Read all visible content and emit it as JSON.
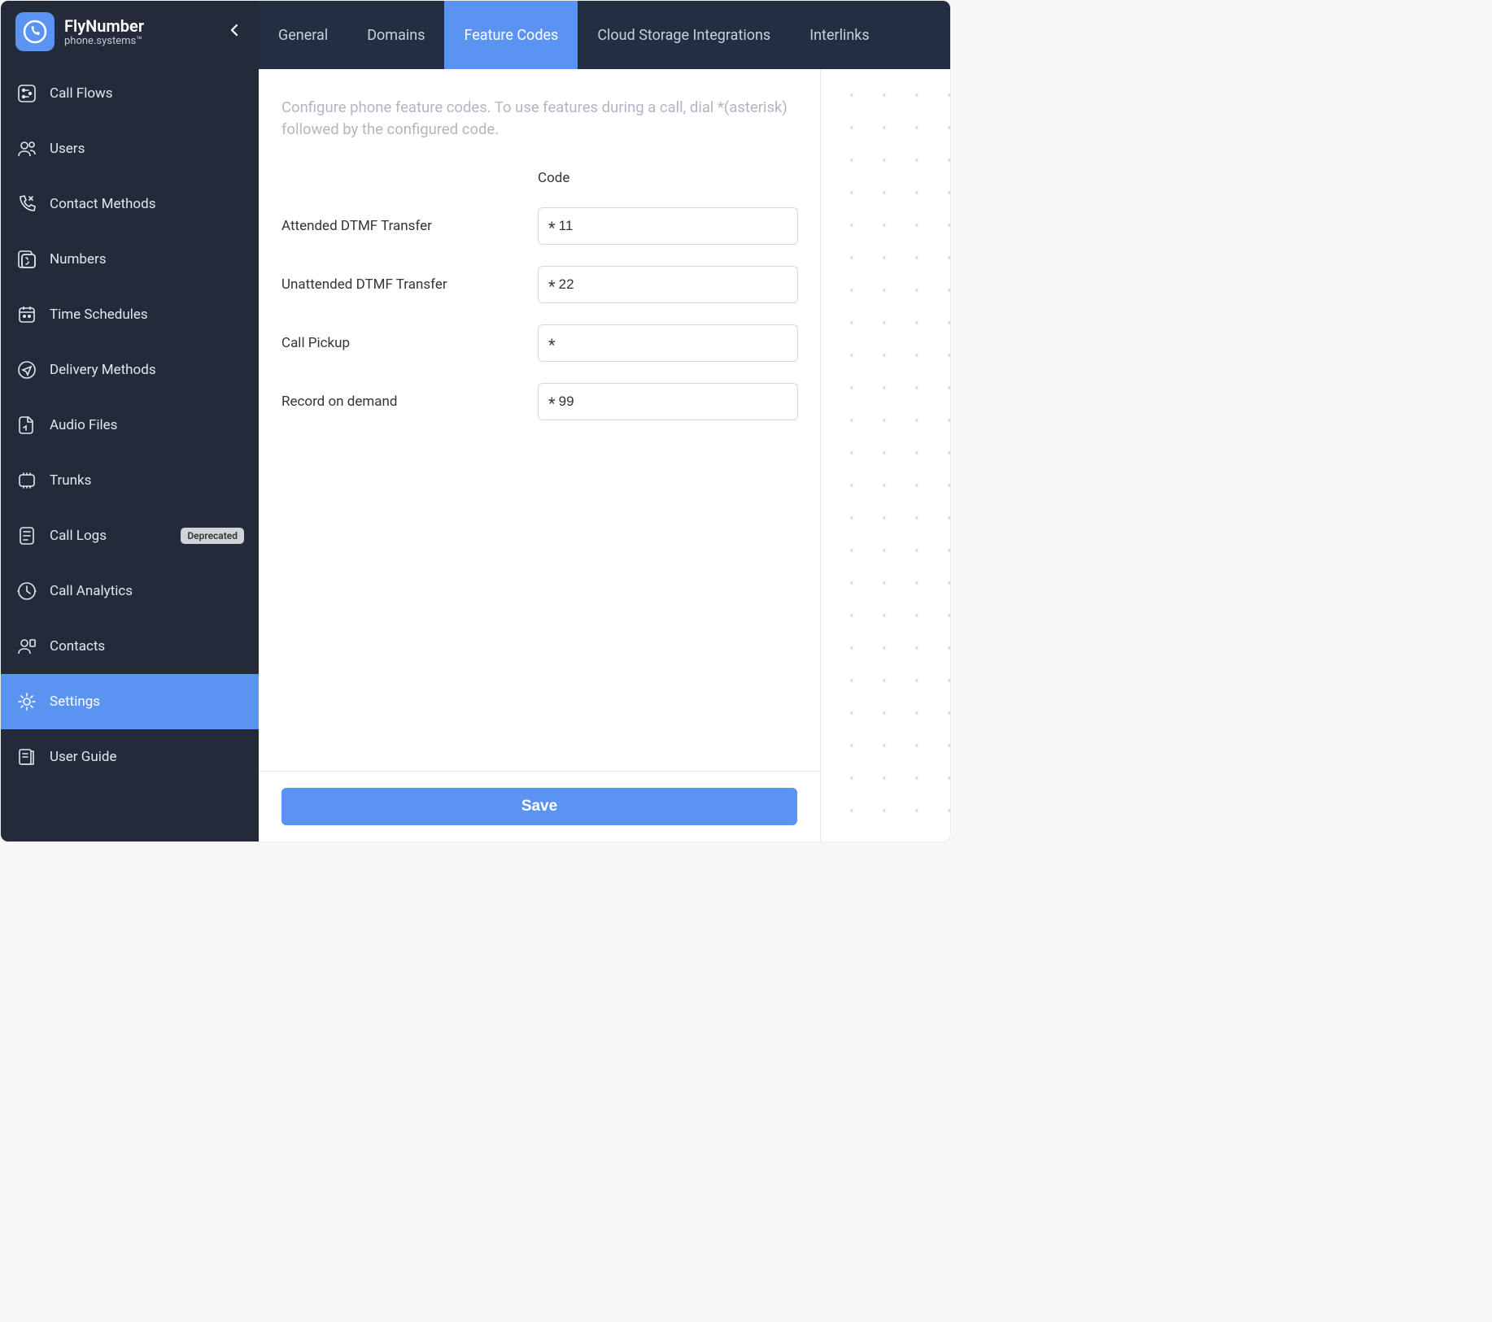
{
  "brand": {
    "title": "FlyNumber",
    "subtitle": "phone.systems™"
  },
  "sidebar": {
    "items": [
      {
        "label": "Call Flows",
        "icon": "flow-icon"
      },
      {
        "label": "Users",
        "icon": "users-icon"
      },
      {
        "label": "Contact Methods",
        "icon": "phone-forward-icon"
      },
      {
        "label": "Numbers",
        "icon": "numbers-icon"
      },
      {
        "label": "Time Schedules",
        "icon": "calendar-icon"
      },
      {
        "label": "Delivery Methods",
        "icon": "send-icon"
      },
      {
        "label": "Audio Files",
        "icon": "audio-file-icon"
      },
      {
        "label": "Trunks",
        "icon": "trunk-icon"
      },
      {
        "label": "Call Logs",
        "icon": "log-icon",
        "badge": "Deprecated"
      },
      {
        "label": "Call Analytics",
        "icon": "analytics-icon"
      },
      {
        "label": "Contacts",
        "icon": "contacts-icon"
      },
      {
        "label": "Settings",
        "icon": "gear-icon",
        "active": true
      },
      {
        "label": "User Guide",
        "icon": "guide-icon"
      }
    ]
  },
  "tabs": {
    "items": [
      {
        "label": "General"
      },
      {
        "label": "Domains"
      },
      {
        "label": "Feature Codes",
        "active": true
      },
      {
        "label": "Cloud Storage Integrations"
      },
      {
        "label": "Interlinks"
      }
    ]
  },
  "content": {
    "description": "Configure phone feature codes. To use features during a call, dial *(asterisk) followed by the configured code.",
    "code_header": "Code",
    "prefix": "*",
    "rows": [
      {
        "label": "Attended DTMF Transfer",
        "value": "11"
      },
      {
        "label": "Unattended DTMF Transfer",
        "value": "22"
      },
      {
        "label": "Call Pickup",
        "value": ""
      },
      {
        "label": "Record on demand",
        "value": "99"
      }
    ]
  },
  "footer": {
    "save_label": "Save"
  }
}
